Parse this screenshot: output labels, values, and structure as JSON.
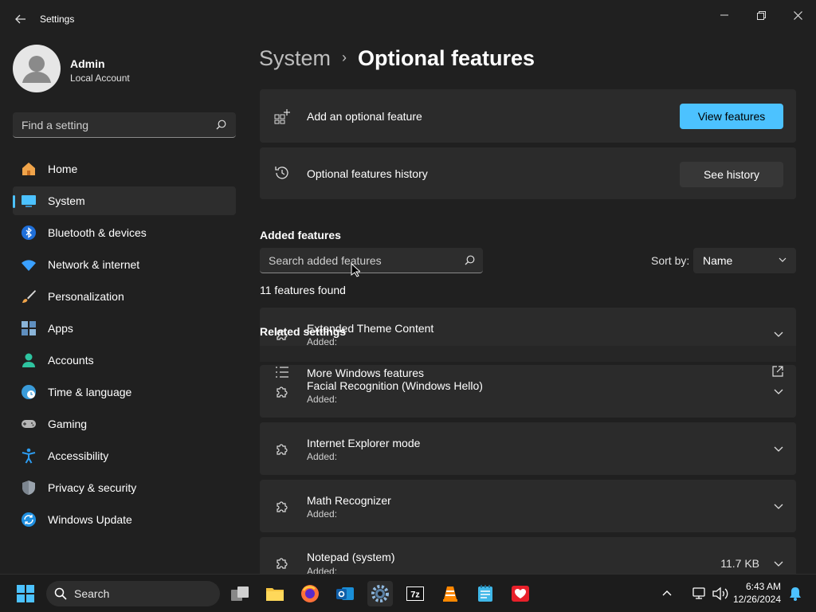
{
  "app": {
    "title": "Settings"
  },
  "profile": {
    "name": "Admin",
    "account_type": "Local Account"
  },
  "find_setting": {
    "placeholder": "Find a setting"
  },
  "nav": [
    {
      "label": "Home",
      "icon": "home-icon"
    },
    {
      "label": "System",
      "icon": "system-icon",
      "selected": true
    },
    {
      "label": "Bluetooth & devices",
      "icon": "bluetooth-icon"
    },
    {
      "label": "Network & internet",
      "icon": "wifi-icon"
    },
    {
      "label": "Personalization",
      "icon": "brush-icon"
    },
    {
      "label": "Apps",
      "icon": "apps-icon"
    },
    {
      "label": "Accounts",
      "icon": "accounts-icon"
    },
    {
      "label": "Time & language",
      "icon": "globe-clock-icon"
    },
    {
      "label": "Gaming",
      "icon": "gamepad-icon"
    },
    {
      "label": "Accessibility",
      "icon": "accessibility-icon"
    },
    {
      "label": "Privacy & security",
      "icon": "shield-icon"
    },
    {
      "label": "Windows Update",
      "icon": "update-icon"
    }
  ],
  "breadcrumb": {
    "parent": "System",
    "separator": "›",
    "current": "Optional features"
  },
  "add_feature": {
    "label": "Add an optional feature",
    "button": "View features"
  },
  "history": {
    "label": "Optional features history",
    "button": "See history"
  },
  "added_features": {
    "title": "Added features",
    "search_placeholder": "Search added features",
    "sort_label": "Sort by:",
    "sort_value": "Name",
    "count_text": "11 features found",
    "items": [
      {
        "name": "Extended Theme Content",
        "status": "Added:"
      },
      {
        "name": "Facial Recognition (Windows Hello)",
        "status": "Added:"
      },
      {
        "name": "Internet Explorer mode",
        "status": "Added:"
      },
      {
        "name": "Math Recognizer",
        "status": "Added:"
      },
      {
        "name": "Notepad (system)",
        "status": "Added:",
        "size": "11.7 KB"
      }
    ]
  },
  "related": {
    "title": "Related settings",
    "more_windows_features": "More Windows features"
  },
  "taskbar": {
    "search_placeholder": "Search",
    "time": "6:43 AM",
    "date": "12/26/2024"
  },
  "colors": {
    "accent": "#4cc2ff",
    "background": "#202020",
    "card": "#2b2b2b"
  }
}
